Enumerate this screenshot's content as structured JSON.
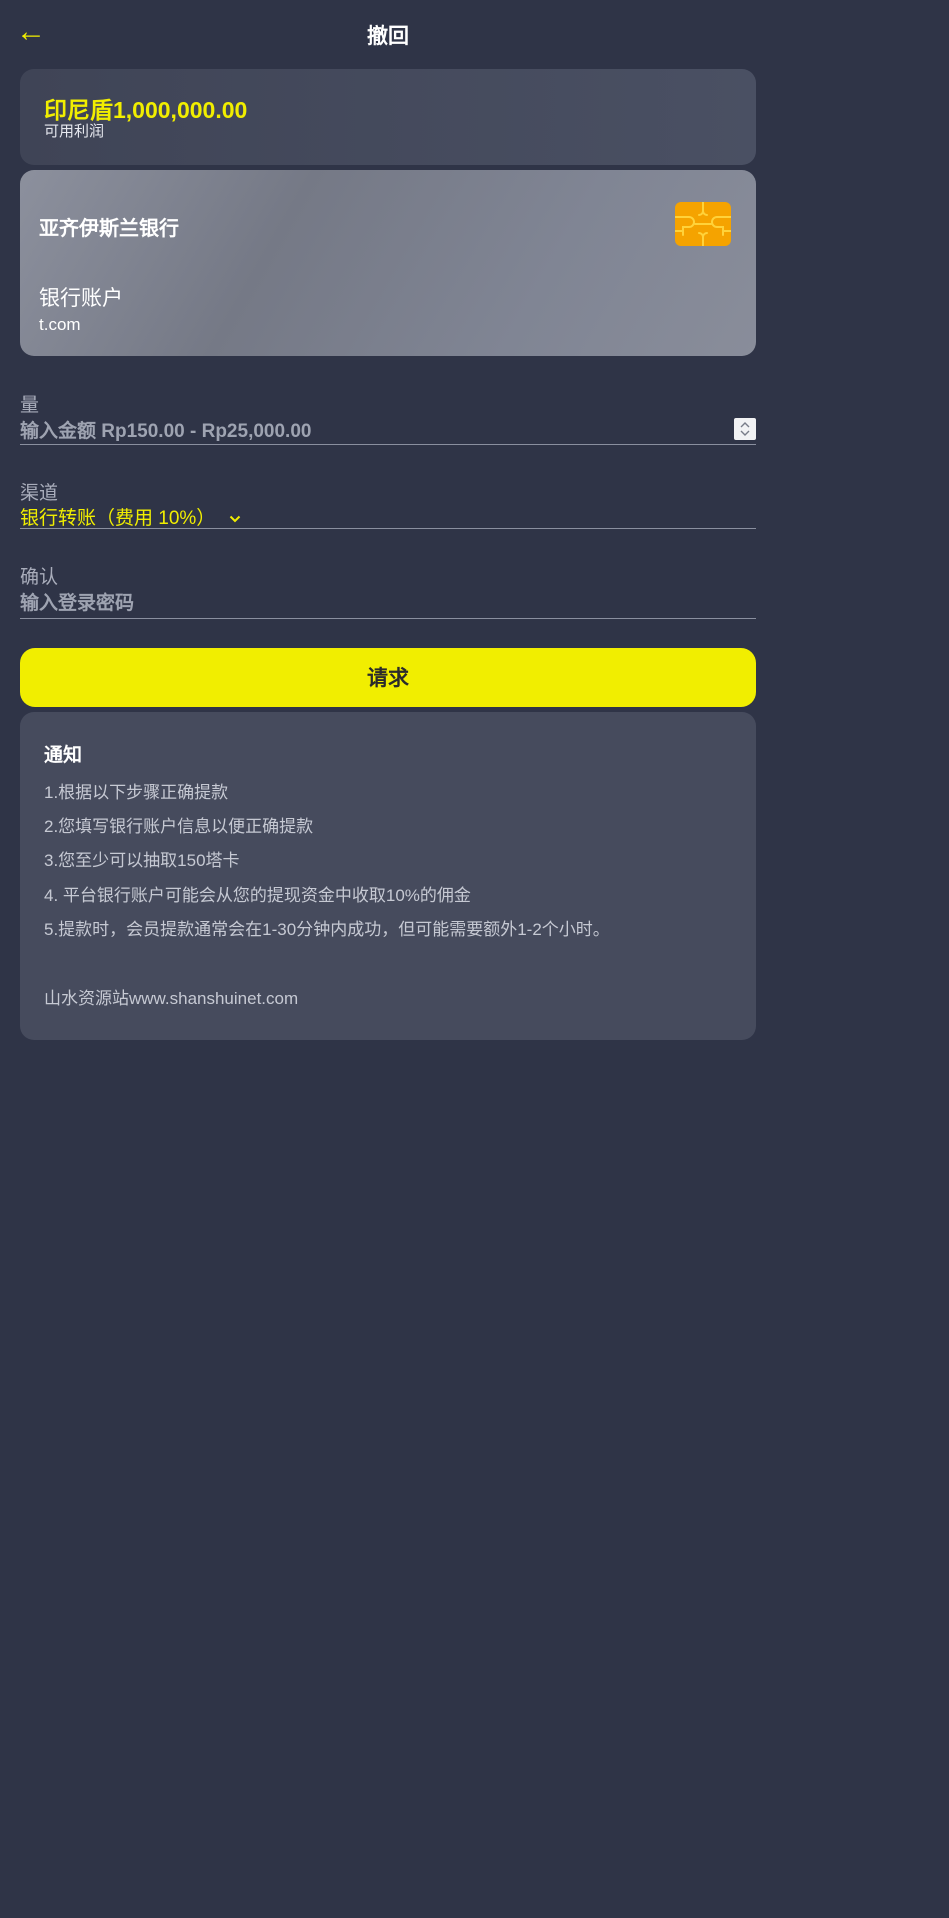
{
  "header": {
    "back_icon": "←",
    "title": "撤回"
  },
  "balance": {
    "amount": "印尼盾1,000,000.00",
    "label": "可用利润"
  },
  "bank_card": {
    "bank_name": "亚齐伊斯兰银行",
    "account_type": "银行账户",
    "account": "t.com",
    "chip_icon": "card-chip-icon"
  },
  "amount_field": {
    "label": "量",
    "placeholder": "输入金额 Rp150.00 - Rp25,000.00"
  },
  "channel_field": {
    "label": "渠道",
    "value": "银行转账（费用 10%）",
    "chevron_icon": "chevron-down-icon"
  },
  "confirm_field": {
    "label": "确认",
    "placeholder": "输入登录密码"
  },
  "submit": {
    "label": "请求"
  },
  "notice": {
    "title": "通知",
    "lines": [
      "1.根据以下步骤正确提款",
      "2.您填写银行账户信息以便正确提款",
      "3.您至少可以抽取150塔卡",
      "4. 平台银行账户可能会从您的提现资金中收取10%的佣金",
      "5.提款时，会员提款通常会在1-30分钟内成功，但可能需要额外1-2个小时。",
      "山水资源站www.shanshuinet.com"
    ]
  },
  "colors": {
    "background": "#2f3447",
    "accent": "#f1ee00",
    "card": "#464b5d",
    "chip": "#f5a300"
  }
}
